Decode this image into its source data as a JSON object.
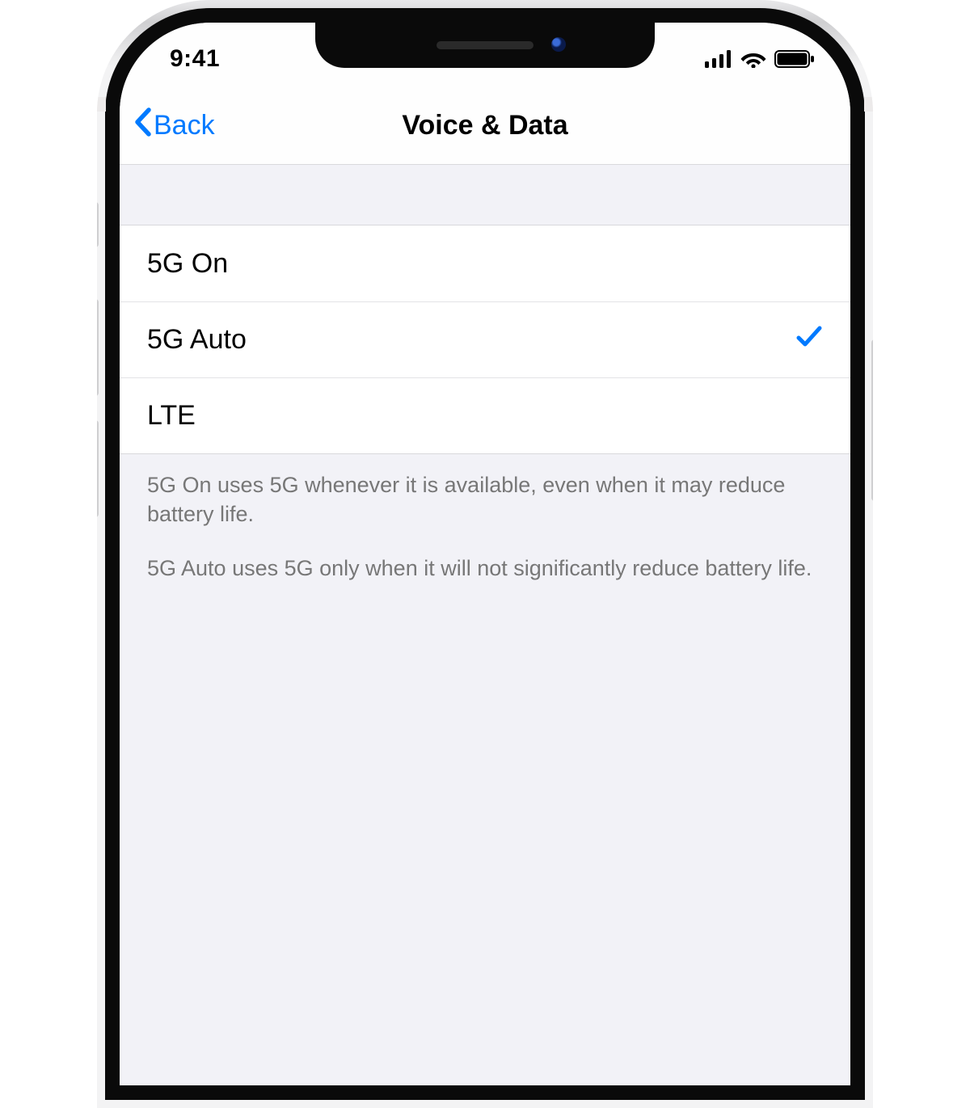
{
  "status": {
    "time": "9:41"
  },
  "nav": {
    "back_label": "Back",
    "title": "Voice & Data"
  },
  "options": [
    {
      "label": "5G On",
      "selected": false
    },
    {
      "label": "5G Auto",
      "selected": true
    },
    {
      "label": "LTE",
      "selected": false
    }
  ],
  "footer": {
    "p1": "5G On uses 5G whenever it is available, even when it may reduce battery life.",
    "p2": "5G Auto uses 5G only when it will not significantly reduce battery life."
  }
}
